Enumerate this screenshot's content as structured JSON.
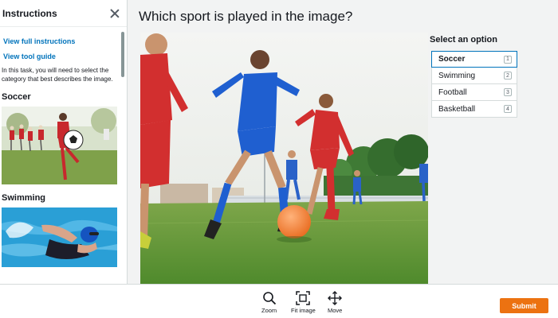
{
  "instructions": {
    "title": "Instructions",
    "view_full_link": "View full instructions",
    "view_tool_link": "View tool guide",
    "description": "In this task, you will need to select the category that best describes the image.",
    "examples": [
      {
        "label": "Soccer"
      },
      {
        "label": "Swimming"
      }
    ]
  },
  "question": "Which sport is played in the image?",
  "options_panel": {
    "label": "Select an option",
    "options": [
      {
        "label": "Soccer",
        "key": "1",
        "selected": true
      },
      {
        "label": "Swimming",
        "key": "2",
        "selected": false
      },
      {
        "label": "Football",
        "key": "3",
        "selected": false
      },
      {
        "label": "Basketball",
        "key": "4",
        "selected": false
      }
    ]
  },
  "toolbar": {
    "zoom_label": "Zoom",
    "fit_label": "Fit image",
    "move_label": "Move",
    "submit_label": "Submit"
  },
  "colors": {
    "accent": "#0073bb",
    "submit": "#ec7211"
  }
}
